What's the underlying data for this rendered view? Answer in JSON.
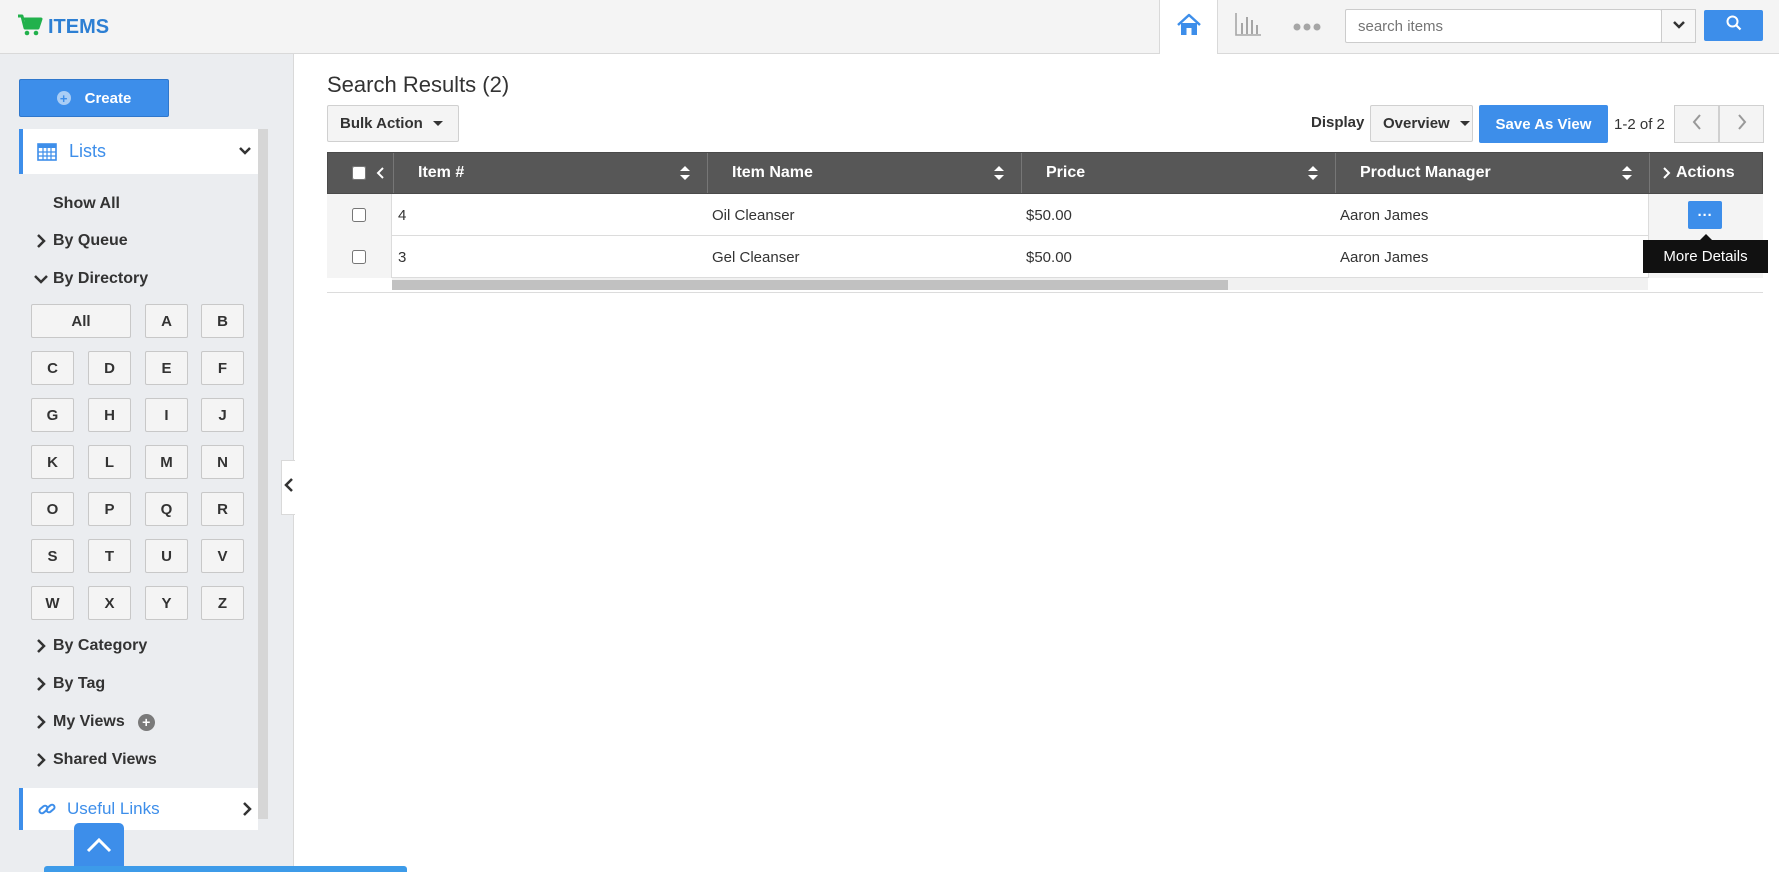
{
  "app": {
    "title": "ITEMS",
    "accent_color": "#3d8eea",
    "brand_icon": "cart-icon"
  },
  "topbar": {
    "nav_icons": [
      "home-icon",
      "chart-icon",
      "more-dots-icon"
    ],
    "search": {
      "placeholder": "search items",
      "value": ""
    }
  },
  "sidebar": {
    "create_label": "Create",
    "lists_label": "Lists",
    "show_all": "Show All",
    "by_queue": "By Queue",
    "by_directory": "By Directory",
    "letters": [
      "All",
      "A",
      "B",
      "C",
      "D",
      "E",
      "F",
      "G",
      "H",
      "I",
      "J",
      "K",
      "L",
      "M",
      "N",
      "O",
      "P",
      "Q",
      "R",
      "S",
      "T",
      "U",
      "V",
      "W",
      "X",
      "Y",
      "Z"
    ],
    "by_category": "By Category",
    "by_tag": "By Tag",
    "my_views": "My Views",
    "shared_views": "Shared Views",
    "useful_links": "Useful Links"
  },
  "main": {
    "title": "Search Results (2)",
    "bulk_action": "Bulk Action",
    "display_label": "Display",
    "display_value": "Overview",
    "save_view": "Save As View",
    "pager_text": "1-2 of 2",
    "columns": [
      "Item #",
      "Item Name",
      "Price",
      "Product Manager",
      "Actions"
    ],
    "rows": [
      {
        "item_no": "4",
        "name": "Oil Cleanser",
        "price": "$50.00",
        "manager": "Aaron James"
      },
      {
        "item_no": "3",
        "name": "Gel Cleanser",
        "price": "$50.00",
        "manager": "Aaron James"
      }
    ],
    "more_button": "···",
    "tooltip": "More Details"
  }
}
